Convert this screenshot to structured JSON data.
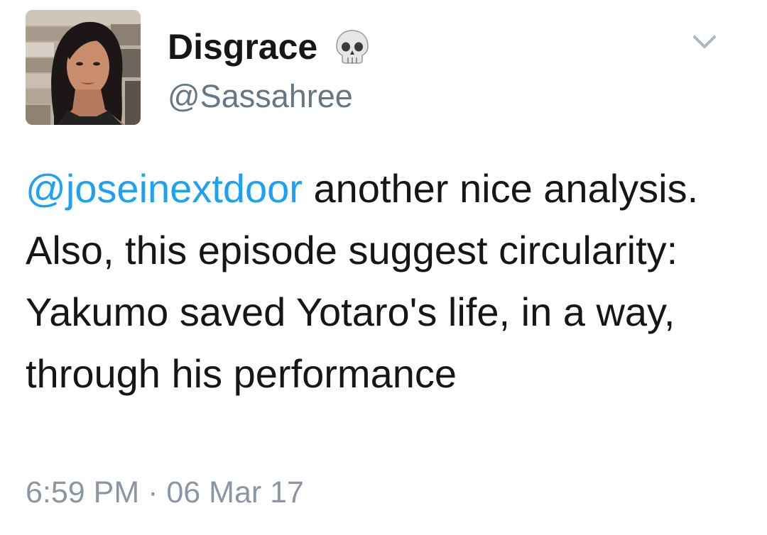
{
  "tweet": {
    "display_name": "Disgrace",
    "name_emoji": "skull-icon",
    "handle": "@Sassahree",
    "mention": "@joseinextdoor",
    "body": " another nice analysis. Also, this episode suggest circularity: Yakumo saved Yotaro's life, in a way, through his performance",
    "timestamp": "6:59 PM · 06 Mar 17"
  },
  "colors": {
    "mention": "#1da1f2",
    "handle": "#657786",
    "timestamp": "#8a96a2",
    "chevron": "#aab8c2"
  },
  "icons": {
    "menu": "chevron-down-icon",
    "avatar": "profile-photo"
  }
}
